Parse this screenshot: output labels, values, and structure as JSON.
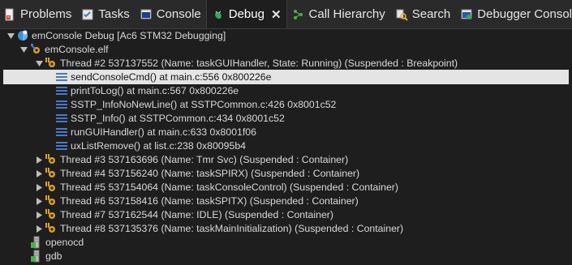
{
  "tabs": [
    {
      "label": "Problems",
      "icon": "problems-icon",
      "active": false
    },
    {
      "label": "Tasks",
      "icon": "tasks-icon",
      "active": false
    },
    {
      "label": "Console",
      "icon": "console-icon",
      "active": false
    },
    {
      "label": "Debug",
      "icon": "debug-icon",
      "active": true,
      "close": "✕"
    },
    {
      "label": "Call Hierarchy",
      "icon": "call-hierarchy-icon",
      "active": false
    },
    {
      "label": "Search",
      "icon": "search-icon",
      "active": false
    },
    {
      "label": "Debugger Console",
      "icon": "debugger-console-icon",
      "active": false
    }
  ],
  "tree": {
    "launch": "emConsole Debug [Ac6 STM32 Debugging]",
    "elf": "emConsole.elf",
    "expanded_thread": "Thread #2 537137552 (Name: taskGUIHandler, State: Running) (Suspended : Breakpoint)",
    "frames": [
      "sendConsoleCmd() at main.c:556 0x800226e",
      "printToLog() at main.c:567 0x800226e",
      "SSTP_InfoNoNewLine() at SSTPCommon.c:426 0x8001c52",
      "SSTP_Info() at SSTPCommon.c:434 0x8001c52",
      "runGUIHandler() at main.c:633 0x8001f06",
      "uxListRemove() at list.c:238 0x80095b4"
    ],
    "threads": [
      "Thread #3 537163696 (Name: Tmr Svc) (Suspended : Container)",
      "Thread #4 537156240 (Name: taskSPIRX) (Suspended : Container)",
      "Thread #5 537154064 (Name: taskConsoleControl) (Suspended : Container)",
      "Thread #6 537158416 (Name: taskSPITX) (Suspended : Container)",
      "Thread #7 537162544 (Name: IDLE) (Suspended : Container)",
      "Thread #8 537135376 (Name: taskMainInitialization) (Suspended : Container)"
    ],
    "processes": [
      "openocd",
      "gdb"
    ]
  },
  "colors": {
    "background": "#1e1e1e",
    "tabbar": "#2a2a2a",
    "selection": "#e4e4e4",
    "thread_gear": "#e0a020",
    "frame_icon": "#4a78c8"
  }
}
